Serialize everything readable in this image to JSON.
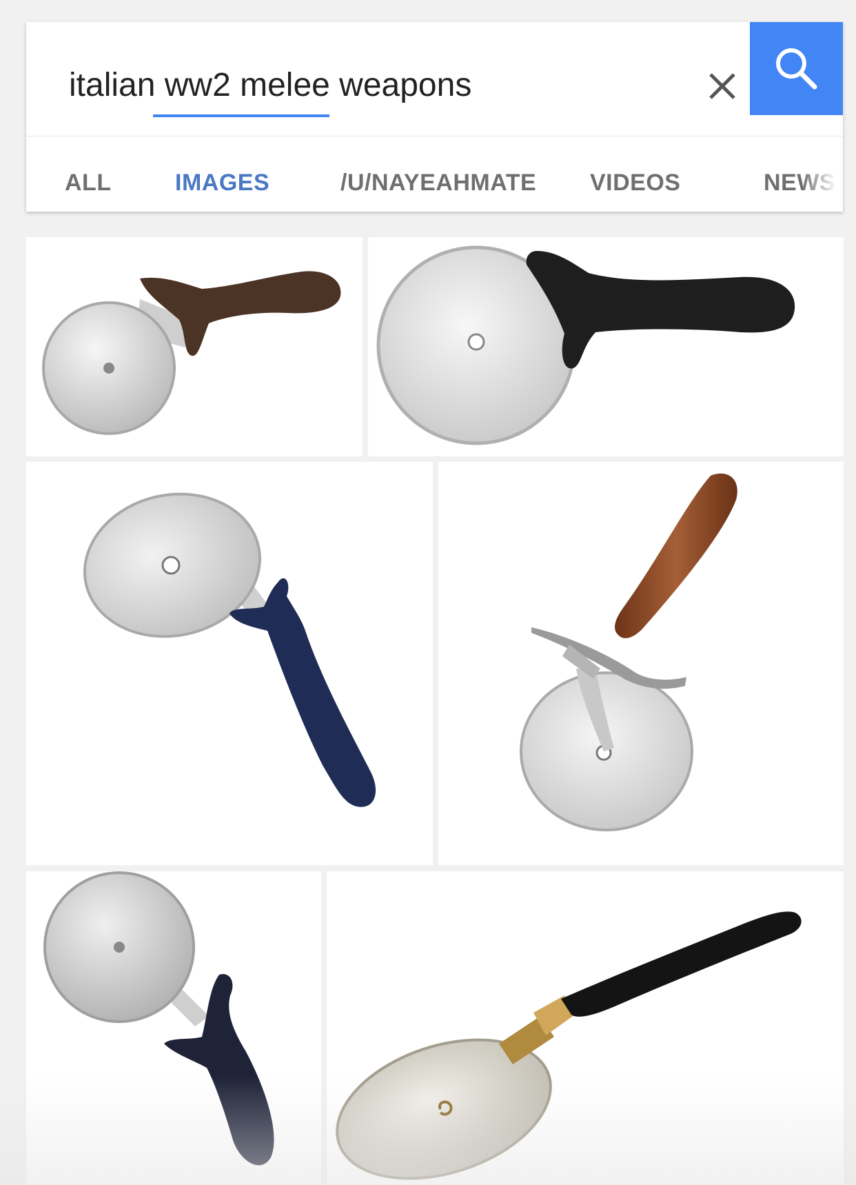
{
  "search": {
    "query": "italian ww2 melee weapons",
    "clear_icon": "close-icon",
    "submit_icon": "search-icon",
    "accent_color": "#4285f4"
  },
  "tabs": [
    {
      "label": "ALL",
      "active": false
    },
    {
      "label": "IMAGES",
      "active": true
    },
    {
      "label": "/U/NAYEAHMATE",
      "active": false
    },
    {
      "label": "VIDEOS",
      "active": false
    },
    {
      "label": "NEWS",
      "active": false
    }
  ],
  "results": [
    {
      "subject": "pizza cutter",
      "handle_color": "#4b3426"
    },
    {
      "subject": "pizza cutter",
      "handle_color": "#1e1e1e"
    },
    {
      "subject": "pizza cutter",
      "handle_color": "#1f2c55"
    },
    {
      "subject": "pizza cutter",
      "handle_color": "#8a4a2a"
    },
    {
      "subject": "pizza cutter",
      "handle_color": "#1f2338"
    },
    {
      "subject": "pizza cutter",
      "handle_color": "#141414"
    }
  ]
}
